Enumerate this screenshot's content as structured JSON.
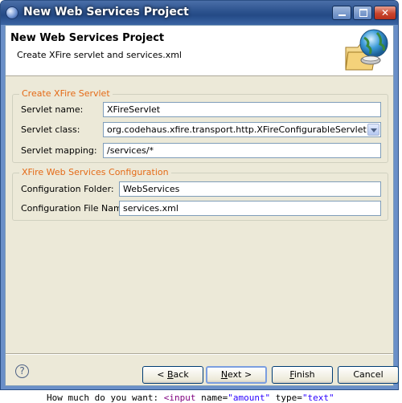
{
  "window": {
    "title": "New Web Services Project"
  },
  "banner": {
    "title": "New Web Services Project",
    "description": "Create XFire servlet and services.xml"
  },
  "servlet_group": {
    "legend": "Create XFire Servlet",
    "name_label": "Servlet name:",
    "name_value": "XFireServlet",
    "class_label": "Servlet class:",
    "class_value": "org.codehaus.xfire.transport.http.XFireConfigurableServlet",
    "mapping_label": "Servlet mapping:",
    "mapping_value": "/services/*"
  },
  "config_group": {
    "legend": "XFire Web Services Configuration",
    "folder_label": "Configuration Folder:",
    "folder_value": "WebServices",
    "file_label": "Configuration File Name:",
    "file_value": "services.xml"
  },
  "buttons": {
    "help": "?",
    "back_prefix": "< ",
    "back_mnemonic": "B",
    "back_rest": "ack",
    "next_mnemonic": "N",
    "next_rest": "ext >",
    "finish_mnemonic": "F",
    "finish_rest": "inish",
    "cancel": "Cancel"
  },
  "background": {
    "text_plain": "How much do you want:",
    "text_tag": "<input",
    "text_attr1": " name=",
    "text_str1": "\"amount\"",
    "text_attr2": " type=",
    "text_str2": "\"text\""
  },
  "colors": {
    "title_bar": "#2f5590",
    "legend_text": "#e46a17",
    "dialog_bg": "#ece9d8"
  }
}
